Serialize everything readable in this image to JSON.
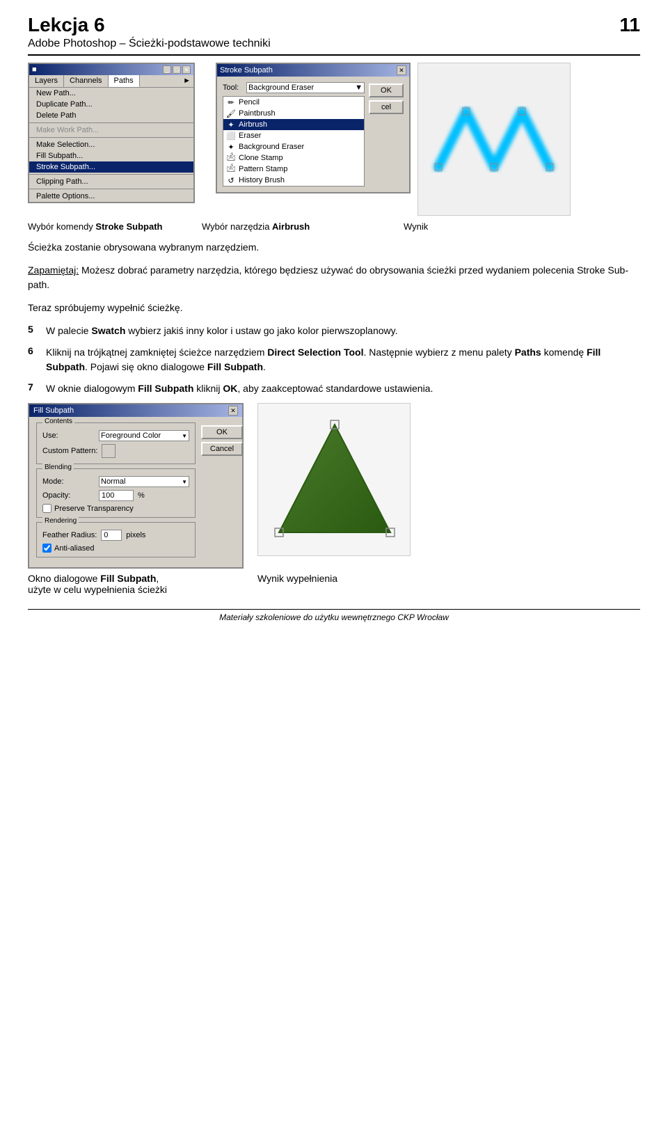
{
  "header": {
    "title": "Lekcja 6",
    "page_number": "11",
    "subtitle": "Adobe Photoshop – Ścieżki-podstawowe techniki"
  },
  "top_section": {
    "menu_title": "Layers",
    "tabs": [
      "Layers",
      "Channels",
      "Paths"
    ],
    "menu_items": [
      {
        "label": "New Path...",
        "state": "normal"
      },
      {
        "label": "Duplicate Path...",
        "state": "normal"
      },
      {
        "label": "Delete Path",
        "state": "normal"
      },
      {
        "label": "separator"
      },
      {
        "label": "Make Work Path...",
        "state": "disabled"
      },
      {
        "label": "separator"
      },
      {
        "label": "Make Selection...",
        "state": "normal"
      },
      {
        "label": "Fill Subpath...",
        "state": "normal"
      },
      {
        "label": "Stroke Subpath...",
        "state": "highlighted"
      },
      {
        "label": "separator"
      },
      {
        "label": "Clipping Path...",
        "state": "normal"
      },
      {
        "label": "separator"
      },
      {
        "label": "Palette Options...",
        "state": "normal"
      }
    ],
    "stroke_dialog": {
      "title": "Stroke Subpath",
      "tool_label": "Tool:",
      "tool_selected": "Background Eraser",
      "tool_list": [
        "Pencil",
        "Paintbrush",
        "Airbrush",
        "Eraser",
        "Background Eraser",
        "Clone Stamp",
        "Pattern Stamp",
        "History Brush"
      ],
      "ok_label": "OK",
      "cancel_label": "cel"
    },
    "result_label": "Wynik",
    "caption_left": "Wybór komendy Stroke Subpath",
    "caption_middle": "Wybór narzędzia Airbrush",
    "caption_right": "Wynik"
  },
  "paragraph1": "Ścieżka zostanie obrysowana wybranym narzędziem.",
  "paragraph2": {
    "prefix_underline": "Zapamiętaj:",
    "text": " Możesz dobrać parametry narzędzia, którego będziesz używać do obrysowania ścieżki przed wydaniem polecenia Stroke Subpath."
  },
  "paragraph3": "Teraz spróbujemy wypełnić ścieżkę.",
  "step5": {
    "num": "5",
    "text_parts": [
      "W palecie ",
      "Swatch",
      " wybierz jakiś inny kolor i ustaw go jako kolor pierwszoplanowy."
    ]
  },
  "step6": {
    "num": "6",
    "text_parts": [
      "Kliknij na trójkątnej zamkniętej ścieżce narzędziem ",
      "Direct Selection Tool",
      ". Następnie wybierz z menu palety ",
      "Paths",
      " komendę ",
      "Fill Subpath",
      ". Pojawi się okno dialogowe ",
      "Fill Subpath",
      "."
    ]
  },
  "step7": {
    "num": "7",
    "text_parts": [
      "W oknie dialogowym ",
      "Fill Subpath",
      " kliknij ",
      "OK",
      ", aby zaakceptować standardowe ustawienia."
    ]
  },
  "fill_dialog": {
    "title": "Fill Subpath",
    "contents_label": "Contents",
    "use_label": "Use:",
    "use_value": "Foreground Color",
    "custom_pattern_label": "Custom Pattern:",
    "blending_label": "Blending",
    "mode_label": "Mode:",
    "mode_value": "Normal",
    "opacity_label": "Opacity:",
    "opacity_value": "100",
    "opacity_unit": "%",
    "preserve_transparency_label": "Preserve Transparency",
    "rendering_label": "Rendering",
    "feather_radius_label": "Feather Radius:",
    "feather_radius_value": "0",
    "feather_radius_unit": "pixels",
    "anti_aliased_label": "Anti-aliased",
    "ok_label": "OK",
    "cancel_label": "Cancel"
  },
  "bottom_captions": {
    "left": "Okno dialogowe Fill Subpath,",
    "left2": "użyte w celu wypełnienia ścieżki",
    "right": "Wynik wypełnienia"
  },
  "footer": {
    "text": "Materiały szkoleniowe do użytku wewnętrznego CKP Wrocław"
  }
}
